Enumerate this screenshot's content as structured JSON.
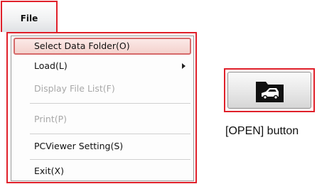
{
  "menu": {
    "title": "File",
    "items": [
      {
        "label": "Select Data Folder(O)",
        "state": "highlighted"
      },
      {
        "label": "Load(L)",
        "state": "enabled",
        "submenu": true
      },
      {
        "label": "Display File List(F)",
        "state": "disabled"
      },
      {
        "label": "Print(P)",
        "state": "disabled"
      },
      {
        "label": "PCViewer Setting(S)",
        "state": "enabled"
      },
      {
        "label": "Exit(X)",
        "state": "enabled"
      }
    ]
  },
  "open_button": {
    "icon": "folder-open-icon",
    "caption": "[OPEN] button"
  },
  "colors": {
    "callout_border": "#e0202a",
    "highlight_fill": "#f4d2cd",
    "disabled_text": "#a8a8a8"
  }
}
